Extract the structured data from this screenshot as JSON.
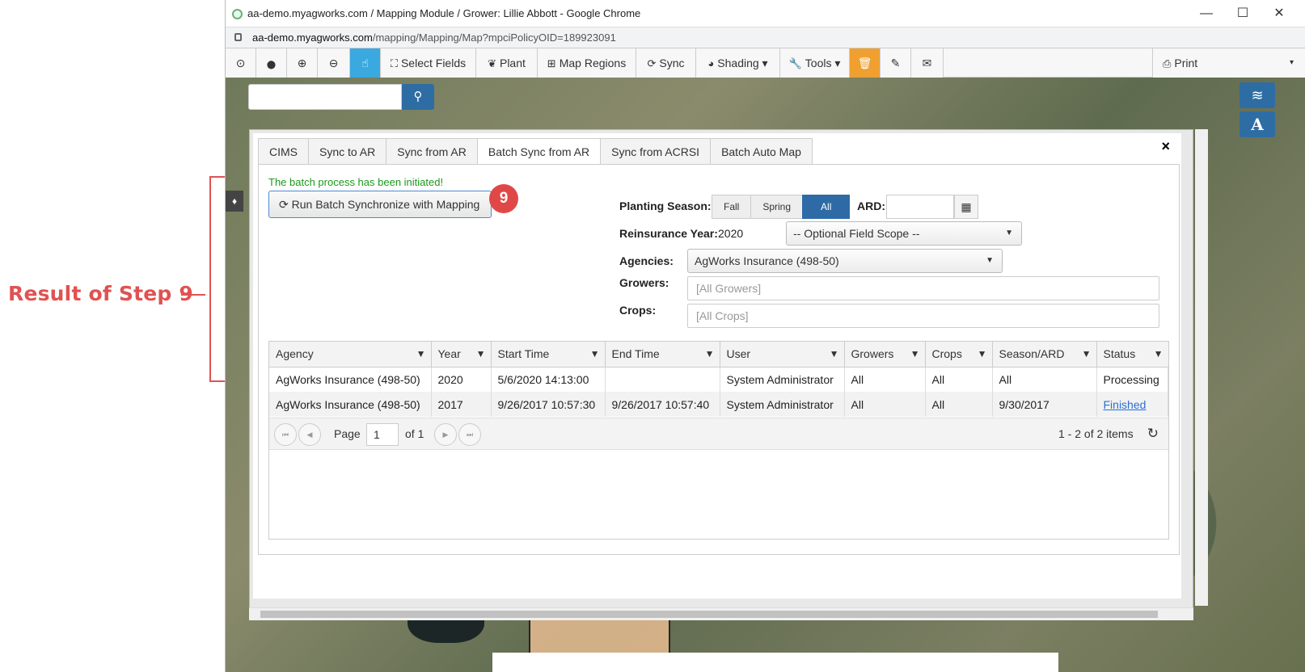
{
  "annotation": {
    "label": "Result of Step 9",
    "step_badge": "9"
  },
  "browser": {
    "title": "aa-demo.myagworks.com / Mapping Module / Grower: Lillie Abbott - Google Chrome",
    "url_host": "aa-demo.myagworks.com",
    "url_path": "/mapping/Mapping/Map?mpciPolicyOID=189923091",
    "win_minimize": "—",
    "win_maximize": "☐",
    "win_close": "✕"
  },
  "toolbar": {
    "locate_icon": "⊙",
    "pin_icon": "⬤",
    "zoom_in_icon": "⊕",
    "zoom_out_icon": "⊖",
    "pointer_icon": "☝",
    "select_fields": "Select Fields",
    "plant": "Plant",
    "map_regions": "Map Regions",
    "sync": "Sync",
    "shading": "Shading ▾",
    "tools": "Tools ▾",
    "trash_icon": "🗑",
    "edit_icon": "✎",
    "mail_icon": "✉",
    "print": "Print",
    "print_caret": "▾"
  },
  "map": {
    "search_placeholder": "",
    "search_icon": "⚲",
    "layers_icon": "≋",
    "labels_icon": "A",
    "drop_icon": "♦"
  },
  "dialog": {
    "close": "×",
    "tabs": [
      "CIMS",
      "Sync to AR",
      "Sync from AR",
      "Batch Sync from AR",
      "Sync from ACRSI",
      "Batch Auto Map"
    ],
    "active_tab": 3,
    "status_message": "The batch process has been initiated!",
    "run_button": "Run Batch Synchronize with Mapping",
    "run_icon": "⟳",
    "planting_season_label": "Planting Season:",
    "seasons": [
      "Fall",
      "Spring",
      "All"
    ],
    "season_selected": "All",
    "ard_label": "ARD:",
    "ard_value": "",
    "calendar_icon": "▦",
    "reinsurance_year_label": "Reinsurance Year:",
    "reinsurance_year": "2020",
    "field_scope": "-- Optional Field Scope --",
    "agencies_label": "Agencies:",
    "agency": "AgWorks Insurance (498-50)",
    "growers_label": "Growers:",
    "growers_placeholder": "[All Growers]",
    "crops_label": "Crops:",
    "crops_placeholder": "[All Crops]",
    "caret": "▼"
  },
  "grid": {
    "columns": [
      "Agency",
      "Year",
      "Start Time",
      "End Time",
      "User",
      "Growers",
      "Crops",
      "Season/ARD",
      "Status"
    ],
    "filter_icon": "▼",
    "rows": [
      [
        "AgWorks Insurance (498-50)",
        "2020",
        "5/6/2020 14:13:00",
        "",
        "System Administrator",
        "All",
        "All",
        "All",
        "Processing"
      ],
      [
        "AgWorks Insurance (498-50)",
        "2017",
        "9/26/2017 10:57:30",
        "9/26/2017 10:57:40",
        "System Administrator",
        "All",
        "All",
        "9/30/2017",
        "Finished"
      ]
    ],
    "pager": {
      "first": "⏮",
      "prev": "◀",
      "next": "▶",
      "last": "⏭",
      "page_label": "Page",
      "page": "1",
      "of_label": "of 1",
      "summary": "1 - 2 of 2 items",
      "refresh_icon": "↻"
    }
  }
}
